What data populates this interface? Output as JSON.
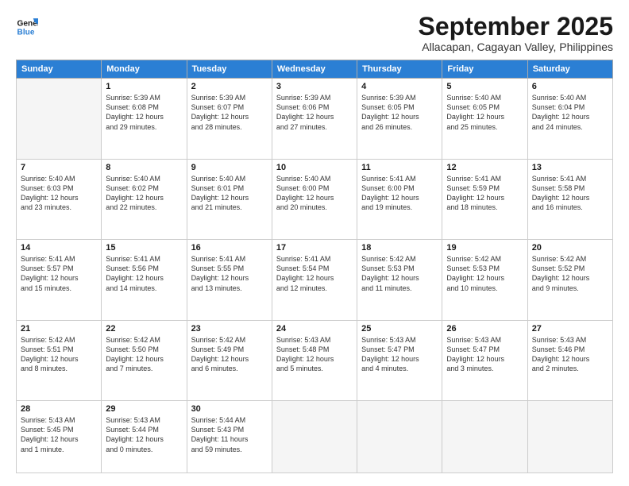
{
  "logo": {
    "line1": "General",
    "line2": "Blue"
  },
  "title": "September 2025",
  "subtitle": "Allacapan, Cagayan Valley, Philippines",
  "days_header": [
    "Sunday",
    "Monday",
    "Tuesday",
    "Wednesday",
    "Thursday",
    "Friday",
    "Saturday"
  ],
  "weeks": [
    [
      {
        "day": "",
        "info": ""
      },
      {
        "day": "1",
        "info": "Sunrise: 5:39 AM\nSunset: 6:08 PM\nDaylight: 12 hours\nand 29 minutes."
      },
      {
        "day": "2",
        "info": "Sunrise: 5:39 AM\nSunset: 6:07 PM\nDaylight: 12 hours\nand 28 minutes."
      },
      {
        "day": "3",
        "info": "Sunrise: 5:39 AM\nSunset: 6:06 PM\nDaylight: 12 hours\nand 27 minutes."
      },
      {
        "day": "4",
        "info": "Sunrise: 5:39 AM\nSunset: 6:05 PM\nDaylight: 12 hours\nand 26 minutes."
      },
      {
        "day": "5",
        "info": "Sunrise: 5:40 AM\nSunset: 6:05 PM\nDaylight: 12 hours\nand 25 minutes."
      },
      {
        "day": "6",
        "info": "Sunrise: 5:40 AM\nSunset: 6:04 PM\nDaylight: 12 hours\nand 24 minutes."
      }
    ],
    [
      {
        "day": "7",
        "info": "Sunrise: 5:40 AM\nSunset: 6:03 PM\nDaylight: 12 hours\nand 23 minutes."
      },
      {
        "day": "8",
        "info": "Sunrise: 5:40 AM\nSunset: 6:02 PM\nDaylight: 12 hours\nand 22 minutes."
      },
      {
        "day": "9",
        "info": "Sunrise: 5:40 AM\nSunset: 6:01 PM\nDaylight: 12 hours\nand 21 minutes."
      },
      {
        "day": "10",
        "info": "Sunrise: 5:40 AM\nSunset: 6:00 PM\nDaylight: 12 hours\nand 20 minutes."
      },
      {
        "day": "11",
        "info": "Sunrise: 5:41 AM\nSunset: 6:00 PM\nDaylight: 12 hours\nand 19 minutes."
      },
      {
        "day": "12",
        "info": "Sunrise: 5:41 AM\nSunset: 5:59 PM\nDaylight: 12 hours\nand 18 minutes."
      },
      {
        "day": "13",
        "info": "Sunrise: 5:41 AM\nSunset: 5:58 PM\nDaylight: 12 hours\nand 16 minutes."
      }
    ],
    [
      {
        "day": "14",
        "info": "Sunrise: 5:41 AM\nSunset: 5:57 PM\nDaylight: 12 hours\nand 15 minutes."
      },
      {
        "day": "15",
        "info": "Sunrise: 5:41 AM\nSunset: 5:56 PM\nDaylight: 12 hours\nand 14 minutes."
      },
      {
        "day": "16",
        "info": "Sunrise: 5:41 AM\nSunset: 5:55 PM\nDaylight: 12 hours\nand 13 minutes."
      },
      {
        "day": "17",
        "info": "Sunrise: 5:41 AM\nSunset: 5:54 PM\nDaylight: 12 hours\nand 12 minutes."
      },
      {
        "day": "18",
        "info": "Sunrise: 5:42 AM\nSunset: 5:53 PM\nDaylight: 12 hours\nand 11 minutes."
      },
      {
        "day": "19",
        "info": "Sunrise: 5:42 AM\nSunset: 5:53 PM\nDaylight: 12 hours\nand 10 minutes."
      },
      {
        "day": "20",
        "info": "Sunrise: 5:42 AM\nSunset: 5:52 PM\nDaylight: 12 hours\nand 9 minutes."
      }
    ],
    [
      {
        "day": "21",
        "info": "Sunrise: 5:42 AM\nSunset: 5:51 PM\nDaylight: 12 hours\nand 8 minutes."
      },
      {
        "day": "22",
        "info": "Sunrise: 5:42 AM\nSunset: 5:50 PM\nDaylight: 12 hours\nand 7 minutes."
      },
      {
        "day": "23",
        "info": "Sunrise: 5:42 AM\nSunset: 5:49 PM\nDaylight: 12 hours\nand 6 minutes."
      },
      {
        "day": "24",
        "info": "Sunrise: 5:43 AM\nSunset: 5:48 PM\nDaylight: 12 hours\nand 5 minutes."
      },
      {
        "day": "25",
        "info": "Sunrise: 5:43 AM\nSunset: 5:47 PM\nDaylight: 12 hours\nand 4 minutes."
      },
      {
        "day": "26",
        "info": "Sunrise: 5:43 AM\nSunset: 5:47 PM\nDaylight: 12 hours\nand 3 minutes."
      },
      {
        "day": "27",
        "info": "Sunrise: 5:43 AM\nSunset: 5:46 PM\nDaylight: 12 hours\nand 2 minutes."
      }
    ],
    [
      {
        "day": "28",
        "info": "Sunrise: 5:43 AM\nSunset: 5:45 PM\nDaylight: 12 hours\nand 1 minute."
      },
      {
        "day": "29",
        "info": "Sunrise: 5:43 AM\nSunset: 5:44 PM\nDaylight: 12 hours\nand 0 minutes."
      },
      {
        "day": "30",
        "info": "Sunrise: 5:44 AM\nSunset: 5:43 PM\nDaylight: 11 hours\nand 59 minutes."
      },
      {
        "day": "",
        "info": ""
      },
      {
        "day": "",
        "info": ""
      },
      {
        "day": "",
        "info": ""
      },
      {
        "day": "",
        "info": ""
      }
    ]
  ]
}
